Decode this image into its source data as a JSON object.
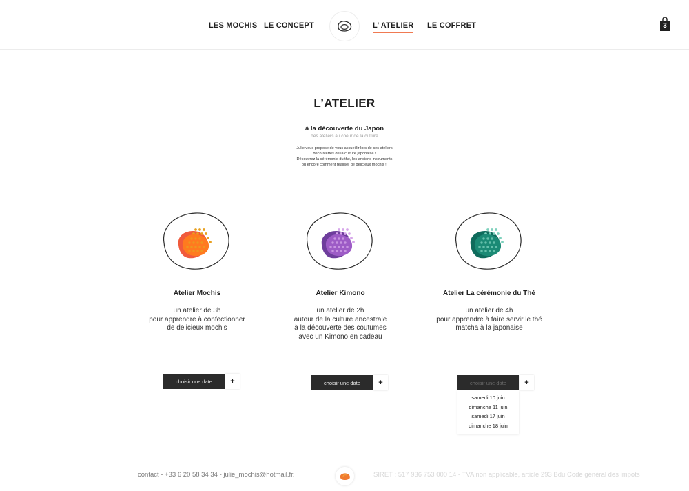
{
  "header": {
    "nav_left": [
      "LES MOCHIS",
      "LE CONCEPT"
    ],
    "nav_right": [
      "L’ ATELIER",
      "LE COFFRET"
    ],
    "cart_count": "3"
  },
  "intro": {
    "title": "L’ATELIER",
    "subtitle": "à la découverte du Japon",
    "subtitle_small": "des ateliers au coeur de la culture",
    "text_lines": [
      "Julie vous propose de vous accueillir lors de ces ateliers",
      "découvertes de la culture japonaise !",
      "Découvrez la cérémonie du thé, les anciens instruments",
      "ou encore comment réaliser de délicieux mochis !!"
    ]
  },
  "cards": [
    {
      "title": "Atelier Mochis",
      "desc": [
        "un atelier de 3h",
        "pour apprendre à confectionner",
        "de delicieux mochis"
      ],
      "button": "choisir une date",
      "plus": "+",
      "colors": {
        "back": "#f05a3c",
        "front": "#ff7a1f",
        "dots": "#e8a020"
      }
    },
    {
      "title": "Atelier Kimono",
      "desc": [
        "un atelier de 2h",
        "autour de la culture ancestrale",
        "à la découverte des coutumes",
        "avec un Kimono en cadeau"
      ],
      "button": "choisir une date",
      "plus": "+",
      "colors": {
        "back": "#6e3d9c",
        "front": "#9d5bc6",
        "dots": "#d7a7ea"
      }
    },
    {
      "title": "Atelier La cérémonie du Thé",
      "desc": [
        "un atelier de 4h",
        "pour apprendre à faire servir le thé",
        "matcha à la japonaise"
      ],
      "button": "choisir une date",
      "plus": "+",
      "colors": {
        "back": "#0f6b5c",
        "front": "#1b8a75",
        "dots": "#7fd1bd"
      }
    }
  ],
  "dropdown": {
    "dates": [
      "samedi 10 juin",
      "dimanche 11 juin",
      "samedi 17 juin",
      "dimanche 18 juin"
    ]
  },
  "footer": {
    "contact": "contact - +33 6 20 58 34 34 - julie_mochis@hotmail.fr.",
    "legal": "SIRET : 517 936 753 000 14 - TVA non applicable, article 293 Bdu Code général des impots"
  }
}
